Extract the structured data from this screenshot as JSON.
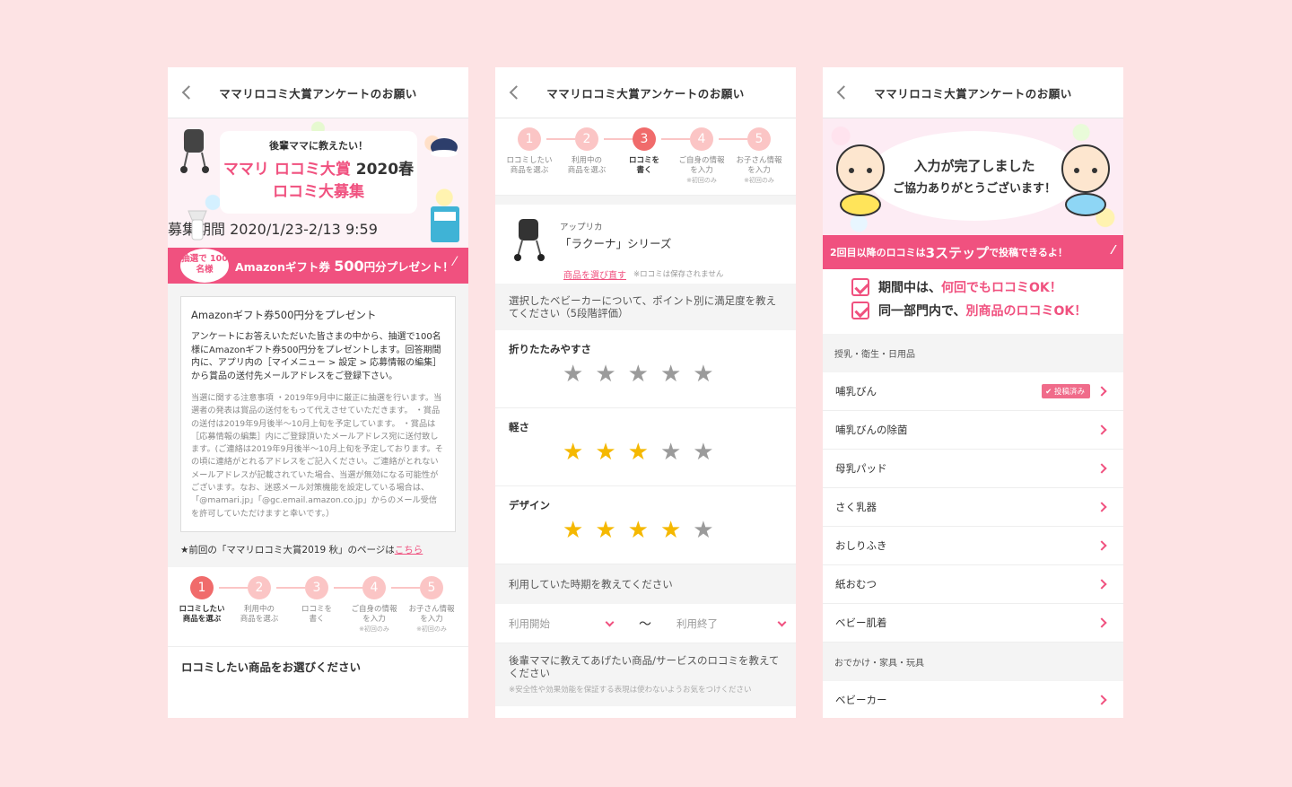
{
  "header_title": "ママリロコミ大賞アンケートのお願い",
  "p1": {
    "banner_tagline": "後輩ママに教えたい！",
    "banner_title_a": "ママリ ロコミ大賞 ",
    "banner_title_year": "2020春",
    "banner_title_b": "ロコミ大募集",
    "period_tag": "募集期間",
    "period": "2020/1/23-2/13 9:59",
    "gift_circle": "抽選で 100名様",
    "gift_text_a": "Amazonギフト券 ",
    "gift_text_big": "500",
    "gift_text_b": "円分プレゼント！",
    "info_head": "Amazonギフト券500円分をプレゼント",
    "info_body": "アンケートにお答えいただいた皆さまの中から、抽選で100名様にAmazonギフト券500円分をプレゼントします。回答期間内に、アプリ内の［マイメニュー > 設定 > 応募情報の編集］から賞品の送付先メールアドレスをご登録下さい。",
    "info_note": "当選に関する注意事項 ・2019年9月中に厳正に抽選を行います。当選者の発表は賞品の送付をもって代えさせていただきます。 ・賞品の送付は2019年9月後半〜10月上旬を予定しています。 ・賞品は［応募情報の編集］内にご登録頂いたメールアドレス宛に送付致します。(ご連絡は2019年9月後半〜10月上旬を予定しております。その頃に連絡がとれるアドレスをご記入ください。ご連絡がとれないメールアドレスが記載されていた場合、当選が無効になる可能性がございます。なお、迷惑メール対策機能を設定している場合は、「@mamari.jp」「@gc.email.amazon.co.jp」からのメール受信を許可していただけますと幸いです。）",
    "prev_text": "★前回の「ママリロコミ大賞2019 秋」のページは",
    "prev_link": "こちら",
    "footer_title": "ロコミしたい商品をお選びください"
  },
  "steps": [
    {
      "num": "1",
      "line1": "ロコミしたい",
      "line2": "商品を選ぶ",
      "sub": ""
    },
    {
      "num": "2",
      "line1": "利用中の",
      "line2": "商品を選ぶ",
      "sub": ""
    },
    {
      "num": "3",
      "line1": "ロコミを",
      "line2": "書く",
      "sub": ""
    },
    {
      "num": "4",
      "line1": "ご自身の情報",
      "line2": "を入力",
      "sub": "※初回のみ"
    },
    {
      "num": "5",
      "line1": "お子さん情報",
      "line2": "を入力",
      "sub": "※初回のみ"
    }
  ],
  "p2": {
    "maker": "アップリカ",
    "product_name": "「ラクーナ」シリーズ",
    "reselect": "商品を選び直す",
    "reselect_note": "※ロコミは保存されません",
    "rating_head": "選択したベビーカーについて、ポイント別に満足度を教えてください（5段階評価）",
    "ratings": [
      {
        "label": "折りたたみやすさ",
        "value": 0
      },
      {
        "label": "軽さ",
        "value": 3
      },
      {
        "label": "デザイン",
        "value": 4
      }
    ],
    "period_head": "利用していた時期を教えてください",
    "start_placeholder": "利用開始",
    "tilde": "〜",
    "end_placeholder": "利用終了",
    "review_head": "後輩ママに教えてあげたい商品/サービスのロコミを教えてください",
    "review_note": "※安全性や効果効能を保証する表現は使わないようお気をつけください"
  },
  "p3": {
    "done1": "入力が完了しました",
    "done2": "ご協力ありがとうございます！",
    "bar_a": "2回目以降のロコミは",
    "bar_big": "3ステップ",
    "bar_b": "で投稿できるよ！",
    "check1_a": "期間中は、",
    "check1_pink": "何回でもロコミOK！",
    "check2_a": "同一部門内で、",
    "check2_pink": "別商品のロコミOK！",
    "cat1": "授乳・衛生・日用品",
    "items": [
      {
        "label": "哺乳びん",
        "badge": "✔ 投稿済み"
      },
      {
        "label": "哺乳びんの除菌",
        "badge": ""
      },
      {
        "label": "母乳パッド",
        "badge": ""
      },
      {
        "label": "さく乳器",
        "badge": ""
      },
      {
        "label": "おしりふき",
        "badge": ""
      },
      {
        "label": "紙おむつ",
        "badge": ""
      },
      {
        "label": "ベビー肌着",
        "badge": ""
      }
    ],
    "cat2": "おでかけ・家具・玩具",
    "items2": [
      {
        "label": "ベビーカー"
      }
    ]
  },
  "colors": {
    "background": "#fde3e4",
    "accent": "#f0517f",
    "star_on": "#f5b800",
    "star_off": "#9b9b9b"
  }
}
